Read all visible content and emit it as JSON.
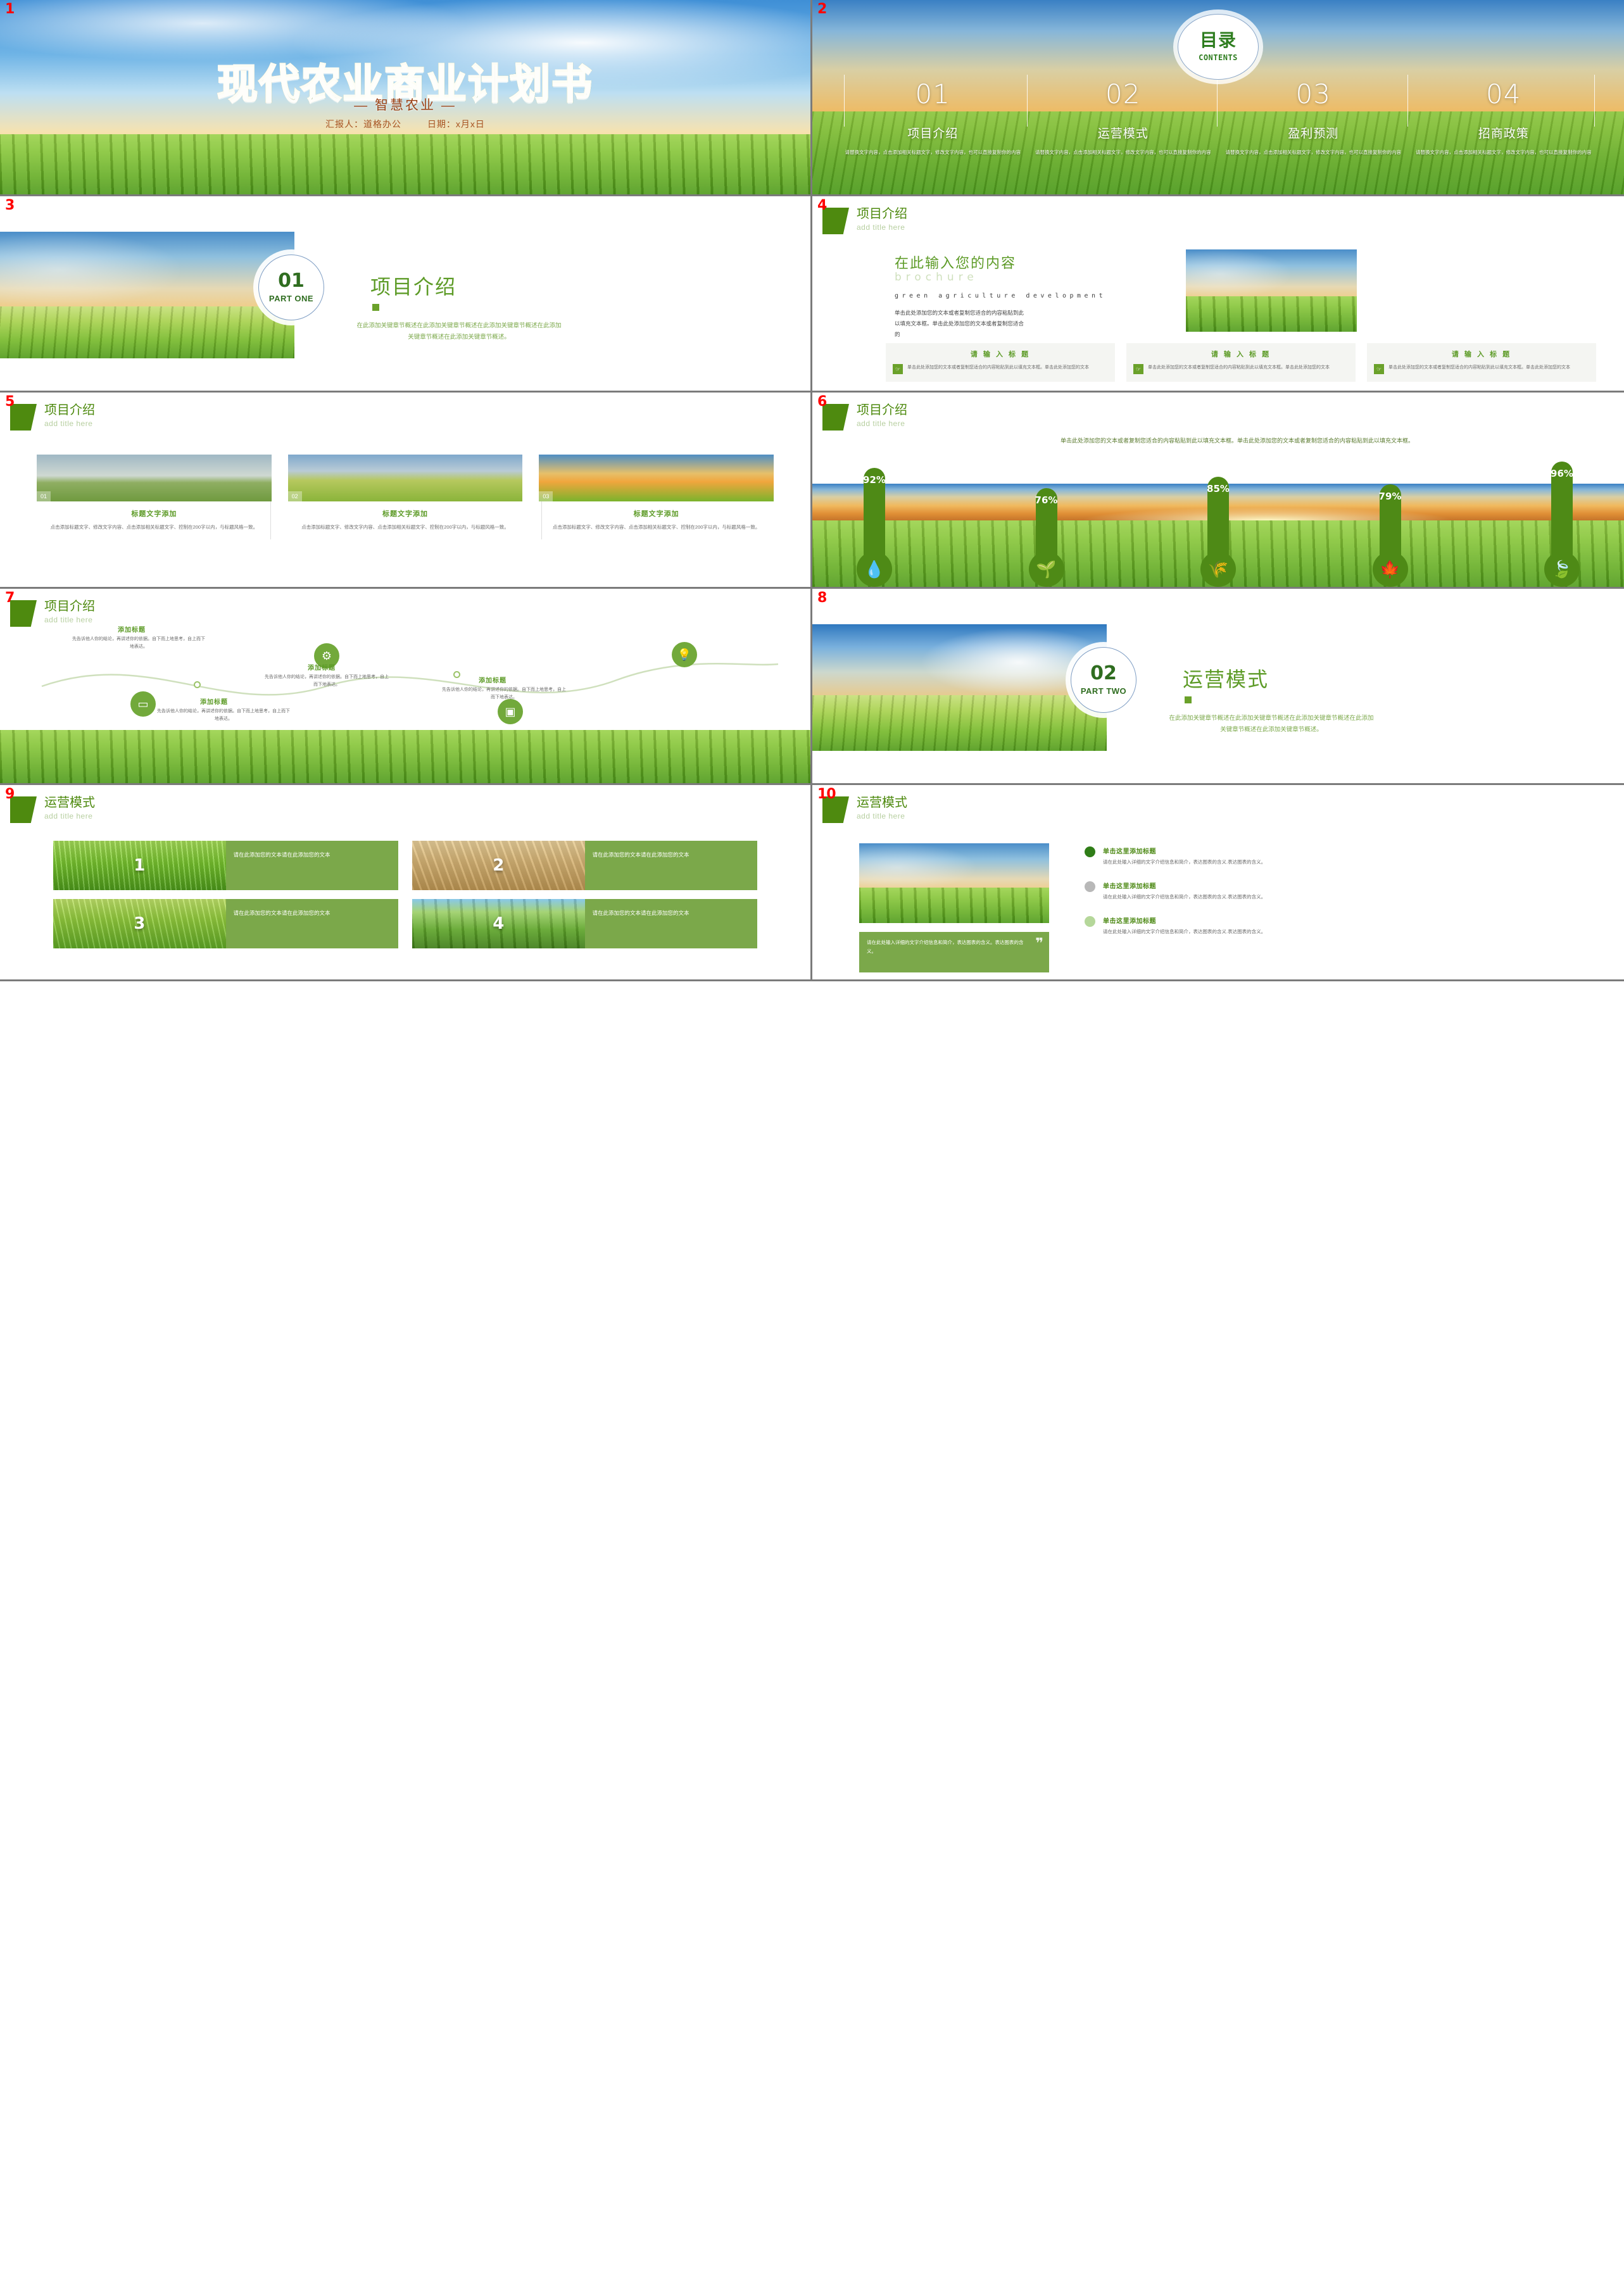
{
  "deck": {
    "slides": [
      {
        "num": "1",
        "title": "现代农业商业计划书",
        "subtitle": "— 智慧农业 —",
        "presenter_label": "汇报人：道格办公",
        "date_label": "日期：x月x日"
      },
      {
        "num": "2",
        "toc_cn": "目录",
        "toc_en": "CONTENTS",
        "items": [
          {
            "num": "01",
            "label": "项目介绍",
            "desc": "请替换文字内容，点击添加相关标题文字，修改文字内容，也可以直接复制你的内容"
          },
          {
            "num": "02",
            "label": "运营模式",
            "desc": "请替换文字内容，点击添加相关标题文字，修改文字内容，也可以直接复制你的内容"
          },
          {
            "num": "03",
            "label": "盈利预测",
            "desc": "请替换文字内容，点击添加相关标题文字，修改文字内容，也可以直接复制你的内容"
          },
          {
            "num": "04",
            "label": "招商政策",
            "desc": "请替换文字内容，点击添加相关标题文字，修改文字内容，也可以直接复制你的内容"
          }
        ]
      },
      {
        "num": "3",
        "circle_num": "01",
        "circle_part": "PART ONE",
        "title": "项目介绍",
        "body": "在此添加关键章节概述在此添加关键章节概述在此添加关键章节概述在此添加关键章节概述在此添加关键章节概述。"
      },
      {
        "num": "4",
        "header_cn": "项目介绍",
        "header_en": "add title here",
        "heading_cn": "在此输入您的内容",
        "heading_en": "brochure",
        "mono_line": "green agriculture development",
        "paragraph": "单击此处添加您的文本或者复制您适合的内容粘贴到此以填充文本框。单击此处添加您的文本或者复制您适合的",
        "cards": [
          {
            "title": "请 输 入 标 题",
            "icon": "hand-pointer-icon",
            "text": "单击此处添加您的文本或者复制您适合的内容粘贴到此以填充文本框。单击此处添加您的文本"
          },
          {
            "title": "请 输 入 标 题",
            "icon": "hand-pointer-icon",
            "text": "单击此处添加您的文本或者复制您适合的内容粘贴到此以填充文本框。单击此处添加您的文本"
          },
          {
            "title": "请 输 入 标 题",
            "icon": "hand-pointer-icon",
            "text": "单击此处添加您的文本或者复制您适合的内容粘贴到此以填充文本框。单击此处添加您的文本"
          }
        ]
      },
      {
        "num": "5",
        "header_cn": "项目介绍",
        "header_en": "add title here",
        "items": [
          {
            "badge": "01",
            "title": "标题文字添加",
            "text": "点击添加标题文字、修改文字内容、点击添加相关标题文字、控制在200字以内，与标题风格一致。"
          },
          {
            "badge": "02",
            "title": "标题文字添加",
            "text": "点击添加标题文字、修改文字内容、点击添加相关标题文字、控制在200字以内，与标题风格一致。"
          },
          {
            "badge": "03",
            "title": "标题文字添加",
            "text": "点击添加标题文字、修改文字内容、点击添加相关标题文字、控制在200字以内，与标题风格一致。"
          }
        ]
      },
      {
        "num": "6",
        "header_cn": "项目介绍",
        "header_en": "add title here",
        "intro": "单击此处添加您的文本或者复制您适合的内容粘贴到此以填充文本框。单击此处添加您的文本或者复制您适合的内容粘贴到此以填充文本框。"
      },
      {
        "num": "7",
        "header_cn": "项目介绍",
        "header_en": "add title here",
        "nodes": [
          {
            "icon": "phone-icon",
            "title": "添加标题",
            "text": "先告诉他人你的结论，再讲述你的依据。自下而上地思考，自上而下地表达。"
          },
          {
            "icon": "gear-icon",
            "title": "添加标题",
            "text": "先告诉他人你的结论，再讲述你的依据。自下而上地思考，自上而下地表达。"
          },
          {
            "icon": "lightbulb-icon",
            "title": "添加标题",
            "text": "先告诉他人你的结论，再讲述你的依据。自下而上地思考，自上而下地表达。"
          },
          {
            "icon": "camera-icon",
            "title": "添加标题",
            "text": "先告诉他人你的结论，再讲述你的依据。自下而上地思考，自上而下地表达。"
          }
        ]
      },
      {
        "num": "8",
        "circle_num": "02",
        "circle_part": "PART TWO",
        "title": "运营模式",
        "body": "在此添加关键章节概述在此添加关键章节概述在此添加关键章节概述在此添加关键章节概述在此添加关键章节概述。"
      },
      {
        "num": "9",
        "header_cn": "运营模式",
        "header_en": "add title here",
        "cells": [
          {
            "n": "1",
            "text": "请在此添加您的文本请在此添加您的文本"
          },
          {
            "n": "2",
            "text": "请在此添加您的文本请在此添加您的文本"
          },
          {
            "n": "3",
            "text": "请在此添加您的文本请在此添加您的文本"
          },
          {
            "n": "4",
            "text": "请在此添加您的文本请在此添加您的文本"
          }
        ]
      },
      {
        "num": "10",
        "header_cn": "运营模式",
        "header_en": "add title here",
        "quote": "请在此处输入详细的文字介绍信息和简介，表达图表的含义。表达图表的含义。",
        "quote_mark": "❞",
        "items": [
          {
            "title": "单击这里添加标题",
            "text": "请在此处输入详细的文字介绍信息和简介，表达图表的含义.表达图表的含义。",
            "color": "#2f7d17"
          },
          {
            "title": "单击这里添加标题",
            "text": "请在此处输入详细的文字介绍信息和简介，表达图表的含义.表达图表的含义。",
            "color": "#b8b8b8"
          },
          {
            "title": "单击这里添加标题",
            "text": "请在此处输入详细的文字介绍信息和简介，表达图表的含义.表达图表的含义。",
            "color": "#b5d79a"
          }
        ]
      }
    ]
  },
  "chart_data": {
    "type": "bar",
    "title": "",
    "categories": [
      "水滴",
      "嫩芽",
      "麦穗",
      "枫叶",
      "绿叶"
    ],
    "values": [
      92,
      76,
      85,
      79,
      96
    ],
    "labels": [
      "92%",
      "76%",
      "85%",
      "79%",
      "96%"
    ],
    "icons": [
      "water-drop-icon",
      "sprout-icon",
      "wheat-icon",
      "maple-leaf-icon",
      "leaf-icon"
    ],
    "icon_glyphs": [
      "💧",
      "🌱",
      "🌾",
      "🍁",
      "🍃"
    ],
    "ylabel": "",
    "xlabel": "",
    "ylim": [
      0,
      100
    ],
    "color": "#4e8a16",
    "grid": false,
    "legend": "none"
  },
  "colors": {
    "brand_green": "#4e8a16",
    "light_green": "#7ba84a",
    "header_green": "#5d9b27",
    "pale_green": "#cfe0bd",
    "slide_number_red": "#ff0000",
    "divider_gray": "#7b7b7b"
  }
}
